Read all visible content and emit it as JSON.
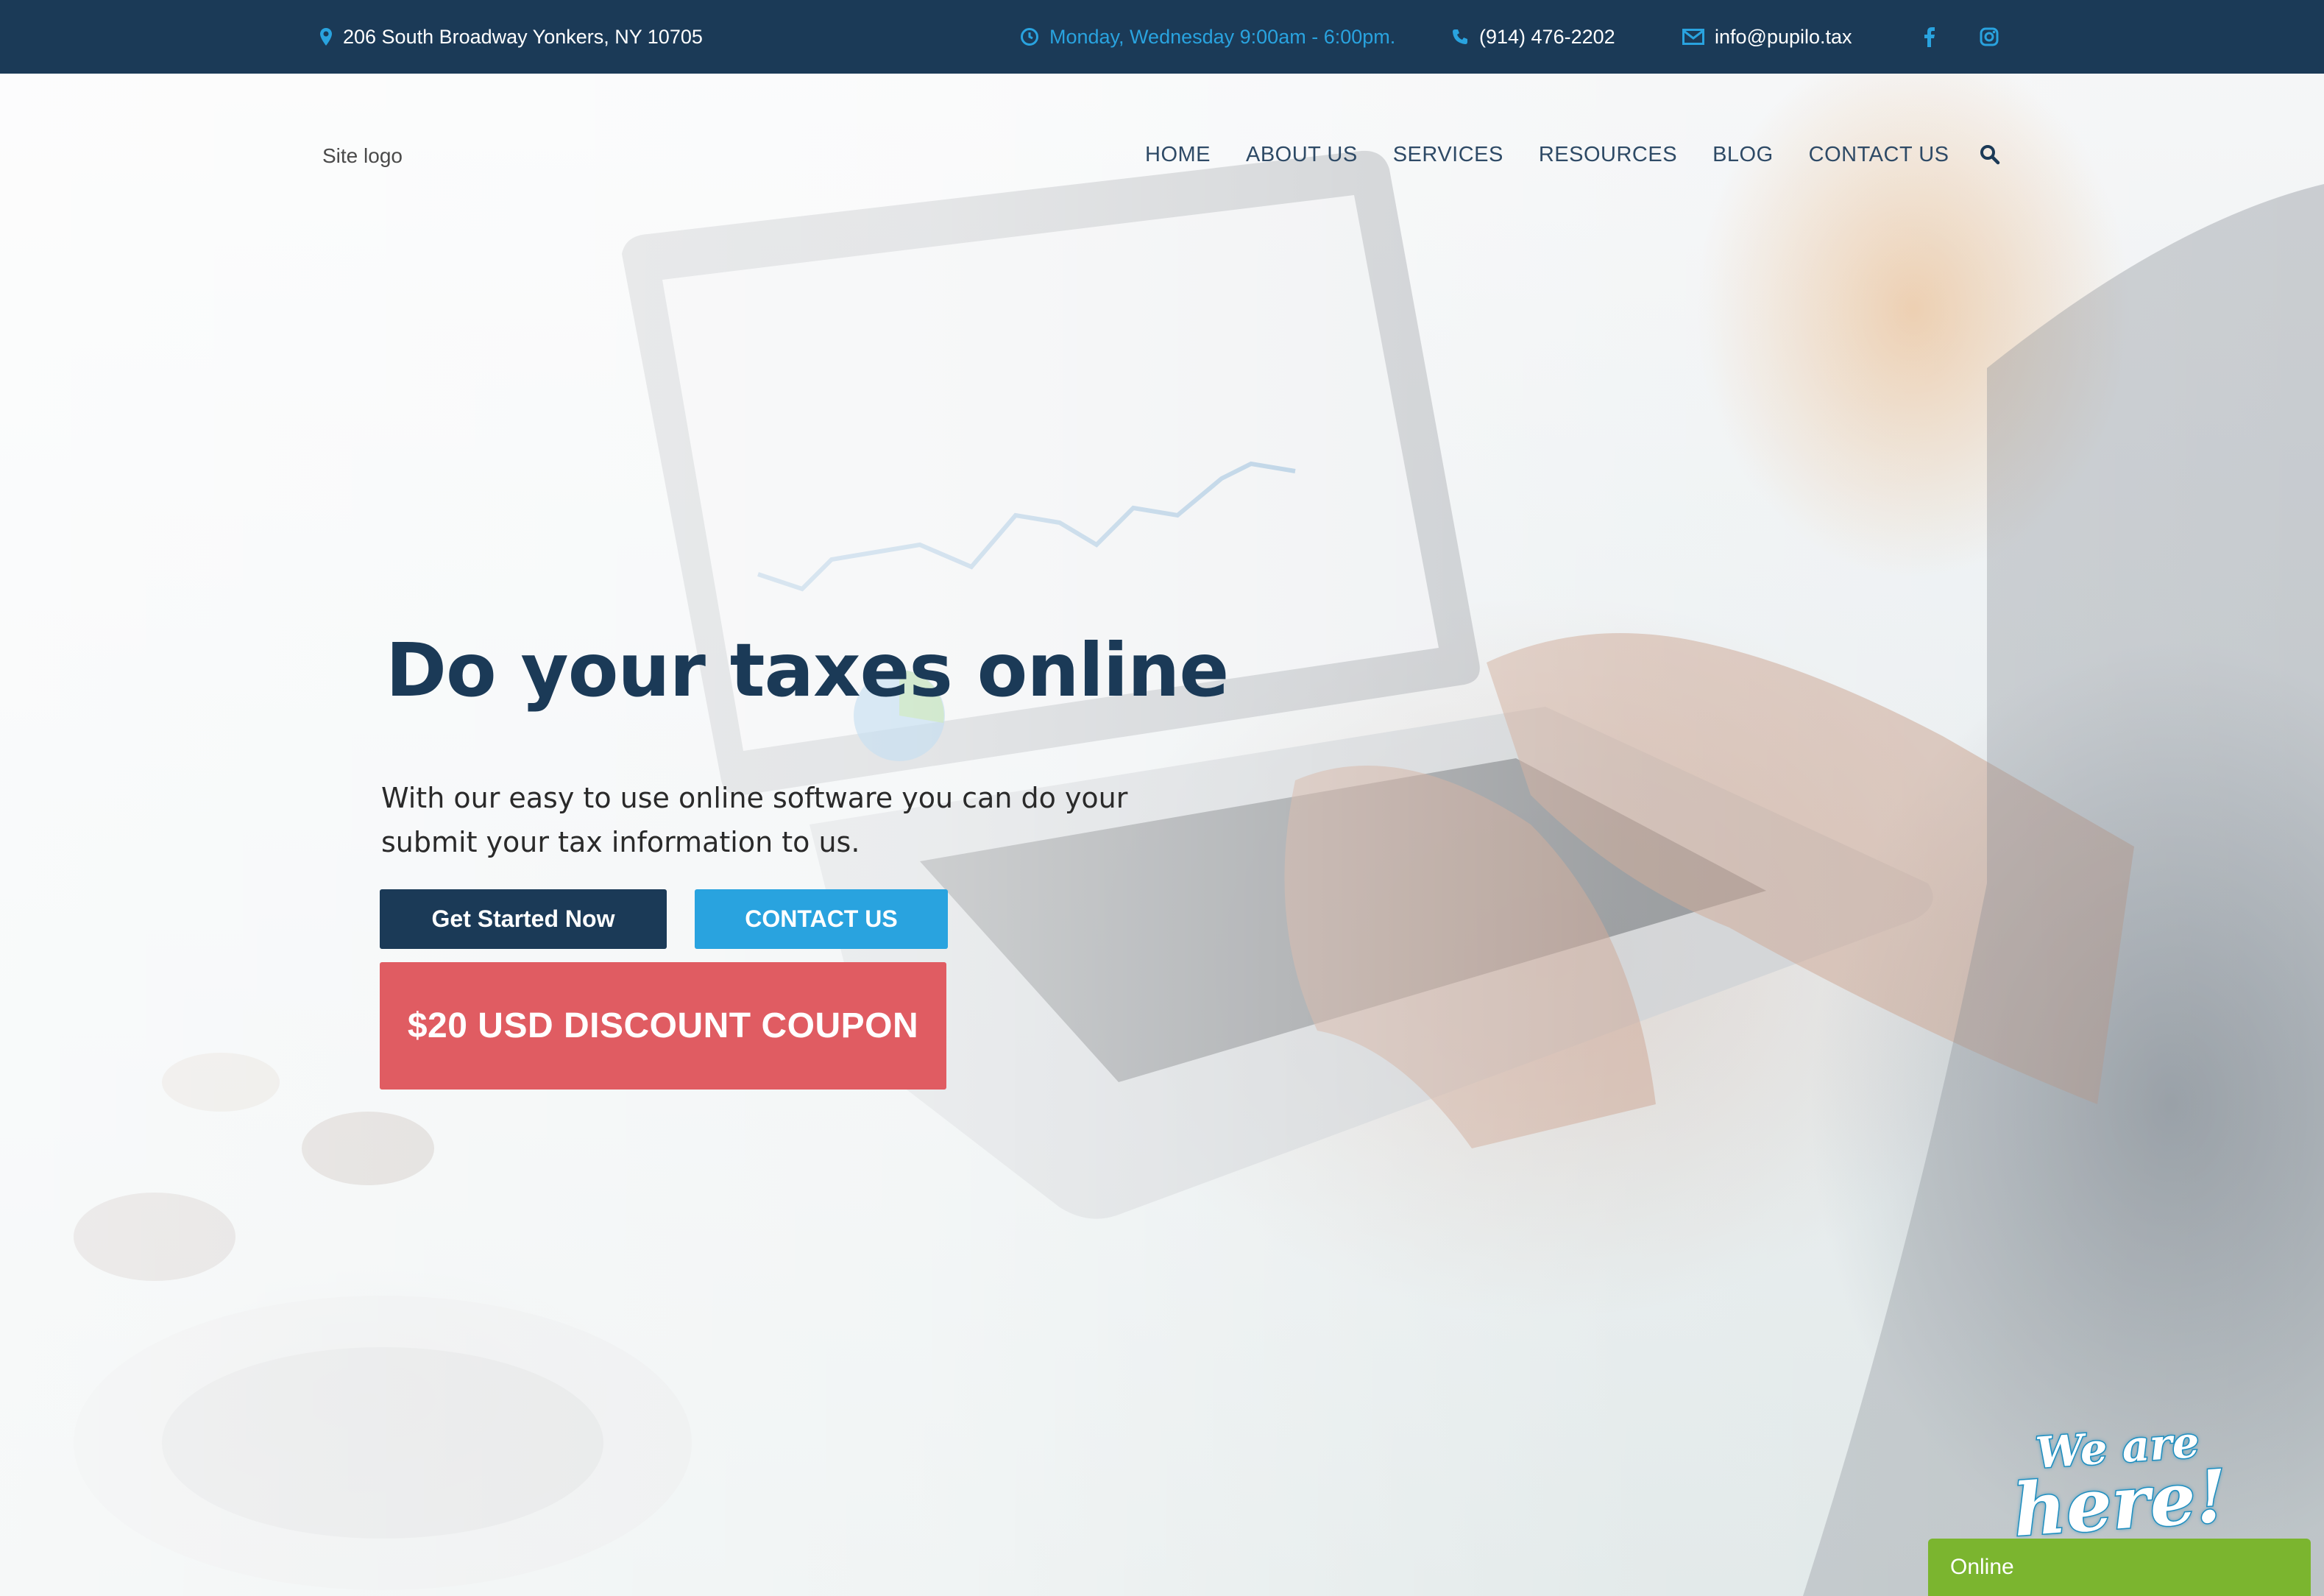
{
  "topbar": {
    "address": "206 South Broadway Yonkers, NY 10705",
    "hours": "Monday, Wednesday 9:00am - 6:00pm.",
    "phone": "(914) 476-2202",
    "email": "info@pupilo.tax",
    "icons": [
      "map-marker-icon",
      "clock-icon",
      "phone-icon",
      "envelope-icon",
      "facebook-icon",
      "instagram-icon"
    ]
  },
  "header": {
    "logo": "Site logo",
    "nav": [
      "HOME",
      "ABOUT US",
      "SERVICES",
      "RESOURCES",
      "BLOG",
      "CONTACT US"
    ]
  },
  "hero": {
    "title": "Do your taxes online",
    "subtitle": "With our easy to use online software you can do your submit your tax information to us.",
    "primary_button": "Get Started Now",
    "secondary_button": "CONTACT US",
    "coupon_button": "$20 USD DISCOUNT COUPON"
  },
  "chat": {
    "badge_line1": "We are",
    "badge_line2": "here!",
    "status": "Online"
  },
  "colors": {
    "topbar": "#1b3a57",
    "accent": "#29a3df",
    "primary": "#1b3a57",
    "coupon": "#e05c62",
    "chat": "#7bb52f"
  }
}
